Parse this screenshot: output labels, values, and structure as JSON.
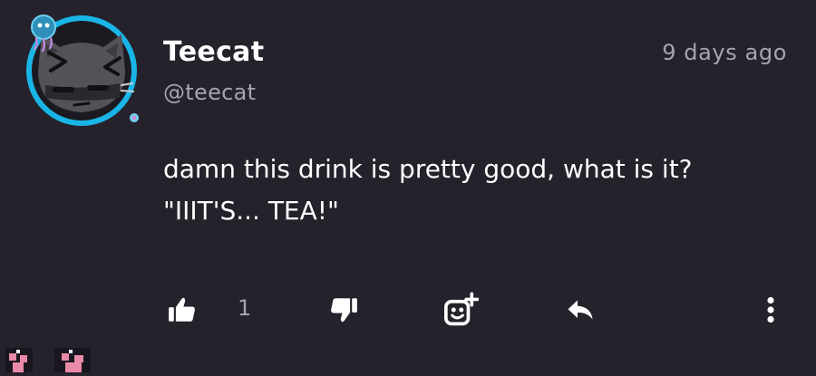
{
  "post": {
    "author": {
      "display_name": "Teecat",
      "handle": "@teecat",
      "avatar_icon": "cat-avatar-icon",
      "avatar_ring_color": "#19b5e6"
    },
    "timestamp": "9 days ago",
    "body_lines": [
      "damn this drink is pretty good, what is it?",
      "\"IIIT'S... TEA!\""
    ]
  },
  "actions": {
    "like": {
      "icon": "thumbs-up-icon",
      "count": "1"
    },
    "dislike": {
      "icon": "thumbs-down-icon"
    },
    "react": {
      "icon": "add-reaction-icon"
    },
    "reply": {
      "icon": "reply-arrow-icon"
    },
    "more": {
      "icon": "more-vertical-icon"
    }
  },
  "colors": {
    "background": "#25222b",
    "text_primary": "#ffffff",
    "text_secondary": "#a7a4ad",
    "accent": "#19b5e6"
  }
}
